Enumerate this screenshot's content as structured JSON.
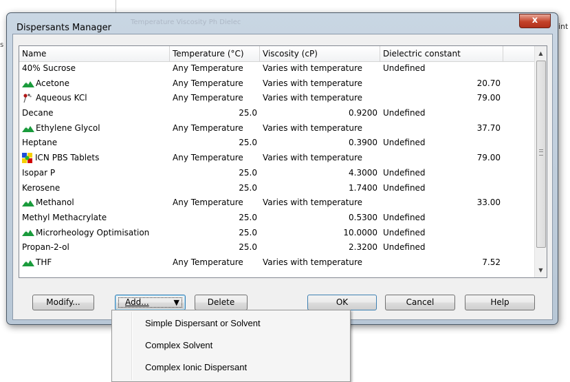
{
  "background": {
    "left_text": "s",
    "right_text": "int"
  },
  "dialog": {
    "title": "Dispersants Manager",
    "title_ghost": "Temperature            Viscosity                         Ph                 Dielec",
    "close_symbol": "x"
  },
  "table": {
    "columns": [
      "Name",
      "Temperature (°C)",
      "Viscosity (cP)",
      "Dielectric constant"
    ],
    "rows": [
      {
        "icon": "none",
        "name": "40% Sucrose",
        "temperature": "Any Temperature",
        "viscosity": "Varies with temperature",
        "dielectric": "Undefined"
      },
      {
        "icon": "mountain-icon",
        "name": "Acetone",
        "temperature": "Any Temperature",
        "viscosity": "Varies with temperature",
        "dielectric": "20.70"
      },
      {
        "icon": "flask-icon",
        "name": "Aqueous KCl",
        "temperature": "Any Temperature",
        "viscosity": "Varies with temperature",
        "dielectric": "79.00"
      },
      {
        "icon": "none",
        "name": "Decane",
        "temperature": "25.0",
        "viscosity": "0.9200",
        "dielectric": "Undefined"
      },
      {
        "icon": "mountain-icon",
        "name": "Ethylene Glycol",
        "temperature": "Any Temperature",
        "viscosity": "Varies with temperature",
        "dielectric": "37.70"
      },
      {
        "icon": "none",
        "name": "Heptane",
        "temperature": "25.0",
        "viscosity": "0.3900",
        "dielectric": "Undefined"
      },
      {
        "icon": "tablets-icon",
        "name": "ICN PBS Tablets",
        "temperature": "Any Temperature",
        "viscosity": "Varies with temperature",
        "dielectric": "79.00"
      },
      {
        "icon": "none",
        "name": "Isopar P",
        "temperature": "25.0",
        "viscosity": "4.3000",
        "dielectric": "Undefined"
      },
      {
        "icon": "none",
        "name": "Kerosene",
        "temperature": "25.0",
        "viscosity": "1.7400",
        "dielectric": "Undefined"
      },
      {
        "icon": "mountain-icon",
        "name": "Methanol",
        "temperature": "Any Temperature",
        "viscosity": "Varies with temperature",
        "dielectric": "33.00"
      },
      {
        "icon": "none",
        "name": "Methyl Methacrylate",
        "temperature": "25.0",
        "viscosity": "0.5300",
        "dielectric": "Undefined"
      },
      {
        "icon": "mountain-icon",
        "name": "Microrheology Optimisation",
        "temperature": "25.0",
        "viscosity": "10.0000",
        "dielectric": "Undefined"
      },
      {
        "icon": "none",
        "name": "Propan-2-ol",
        "temperature": "25.0",
        "viscosity": "2.3200",
        "dielectric": "Undefined"
      },
      {
        "icon": "mountain-icon",
        "name": "THF",
        "temperature": "Any Temperature",
        "viscosity": "Varies with temperature",
        "dielectric": "7.52"
      }
    ]
  },
  "buttons": {
    "modify": "Modify...",
    "add": "Add...",
    "add_arrow": "▼",
    "delete": "Delete",
    "ok": "OK",
    "cancel": "Cancel",
    "help": "Help"
  },
  "add_menu": {
    "items": [
      "Simple Dispersant or Solvent",
      "Complex Solvent",
      "Complex Ionic Dispersant"
    ]
  },
  "colors": {
    "mountain_green": "#1a9b3c",
    "close_red": "#c4432a",
    "frame_blue": "#c9d6e3"
  }
}
